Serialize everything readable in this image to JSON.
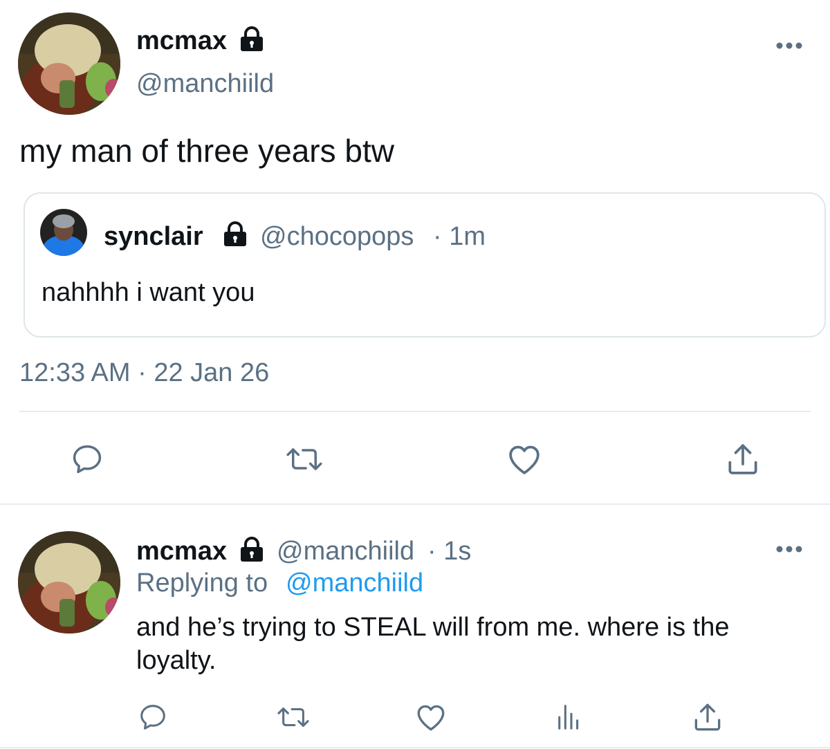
{
  "main_tweet": {
    "display_name": "mcmax",
    "handle": "@manchiild",
    "text": "my man of three years btw",
    "timestamp": "12:33 AM · 22 Jan 26",
    "quoted": {
      "display_name": "synclair",
      "handle": "@chocopops",
      "time": "· 1m",
      "text": "nahhhh i want you"
    }
  },
  "reply_tweet": {
    "display_name": "mcmax",
    "handle": "@manchiild",
    "time": "· 1s",
    "replying_prefix": "Replying to",
    "replying_handle": "@manchiild",
    "text_line1": "and he’s trying to STEAL will from me. where is the",
    "text_line2": "loyalty."
  },
  "icons": {
    "more": "more-icon",
    "reply": "reply-icon",
    "retweet": "retweet-icon",
    "like": "like-icon",
    "share": "share-icon",
    "analytics": "analytics-icon",
    "lock": "lock-icon"
  },
  "colors": {
    "text": "#0f1419",
    "secondary": "#5b7083",
    "link": "#1d9bf0",
    "border": "#e6ecf0"
  }
}
